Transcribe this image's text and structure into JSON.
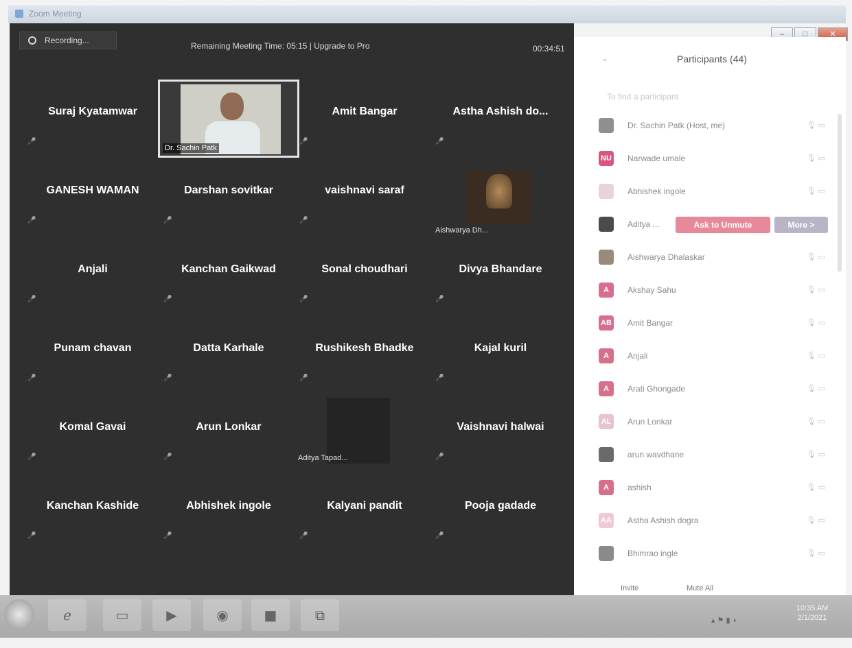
{
  "window": {
    "title": "Zoom Meeting"
  },
  "topbar": {
    "recording_label": "Recording...",
    "remaining_text": "Remaining Meeting Time: 05:15 | Upgrade to Pro",
    "timer": "00:34:51"
  },
  "tiles": [
    "Suraj Kyatamwar",
    "Amit  Bangar",
    "Astha Ashish do...",
    "GANESH WAMAN",
    "Darshan sovitkar",
    "vaishnavi saraf",
    "Anjali",
    "Kanchan Gaikwad",
    "Sonal choudhari",
    "Divya Bhandare",
    "Punam chavan",
    "Datta Karhale",
    "Rushikesh Bhadke",
    "Kajal kuril",
    "Komal Gavai",
    "Arun Lonkar",
    "Vaishnavi halwai",
    "Kanchan Kashide",
    "Abhishek ingole",
    "Kalyani pandit",
    "Pooja gadade"
  ],
  "video_tiles": {
    "sachin": "Dr. Sachin Patk",
    "aishwarya": "Aishwarya Dh...",
    "aditya": "Aditya Tapad..."
  },
  "participants": {
    "title": "Participants (44)",
    "search_placeholder": "To find a participant",
    "list": [
      {
        "initials": "",
        "name": "Dr. Sachin Patk (Host, me)",
        "color": "#8f8f8f"
      },
      {
        "initials": "NU",
        "name": "Narwade umale",
        "color": "#d9567d"
      },
      {
        "initials": "",
        "name": "Abhishek ingole",
        "color": "#e7d3db"
      },
      {
        "initials": "",
        "name": "Aditya ...",
        "color": "#4b4b4b"
      },
      {
        "initials": "",
        "name": "Aishwarya Dhalaskar",
        "color": "#9a8a7a"
      },
      {
        "initials": "A",
        "name": "Akshay Sahu",
        "color": "#d66f8c"
      },
      {
        "initials": "AB",
        "name": "Amit Bangar",
        "color": "#d66f8c"
      },
      {
        "initials": "A",
        "name": "Anjali",
        "color": "#d66f8c"
      },
      {
        "initials": "A",
        "name": "Arati Ghongade",
        "color": "#d66f8c"
      },
      {
        "initials": "AL",
        "name": "Arun Lonkar",
        "color": "#e7c3cf"
      },
      {
        "initials": "",
        "name": "arun wavdhane",
        "color": "#6a6a6a"
      },
      {
        "initials": "A",
        "name": "ashish",
        "color": "#d66f8c"
      },
      {
        "initials": "AA",
        "name": "Astha Ashish dogra",
        "color": "#f0c9d5"
      },
      {
        "initials": "",
        "name": "Bhimrao ingle",
        "color": "#8a8a8a"
      }
    ],
    "ask_to_unmute": "Ask to Unmute",
    "more": "More >",
    "invite": "Invite",
    "mute_all": "Mute All"
  },
  "taskbar": {
    "clock_time": "10:35 AM",
    "clock_date": "2/1/2021"
  }
}
